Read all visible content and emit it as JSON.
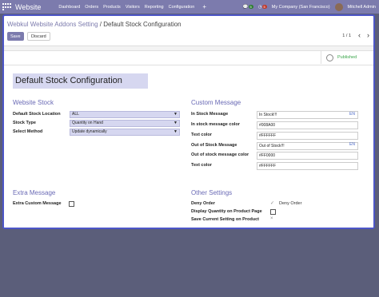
{
  "topbar": {
    "app_name": "Website",
    "menu": [
      "Dashboard",
      "Orders",
      "Products",
      "Visitors",
      "Reporting",
      "Configuration"
    ],
    "plus": "+",
    "chat_count": "5",
    "activity_count": "5",
    "company": "My Company (San Francisco)",
    "user": "Mitchell Admin"
  },
  "breadcrumb": {
    "parent": "Webkul Website Addons Setting",
    "separator": " / ",
    "current": "Default Stock Configuration"
  },
  "buttons": {
    "save": "Save",
    "discard": "Discard"
  },
  "pager": {
    "text": "1 / 1",
    "prev": "‹",
    "next": "›"
  },
  "status": {
    "published": "Published"
  },
  "record_name": "Default Stock Configuration",
  "website_stock": {
    "title": "Website Stock",
    "location_label": "Default Stock Location",
    "location_value": "ALL",
    "type_label": "Stock Type",
    "type_value": "Quantity on Hand",
    "method_label": "Select Method",
    "method_value": "Update dynamically"
  },
  "custom_message": {
    "title": "Custom Message",
    "in_stock_label": "In Stock Message",
    "in_stock_value": "In Stock!!!",
    "in_color_label": "In stock message color",
    "in_color_value": "#008A00",
    "text_color_label": "Text color",
    "text_color_value": "#FFFFFF",
    "out_label": "Out of Stock Message",
    "out_value": "Out of Stock!!!",
    "out_color_label": "Out of stock message color",
    "out_color_value": "#FF0000",
    "text_color2_label": "Text color",
    "text_color2_value": "#FFFFFF",
    "lang": "EN"
  },
  "extra_message": {
    "title": "Extra Message",
    "custom_label": "Extra Custom Message"
  },
  "other_settings": {
    "title": "Other Settings",
    "deny_label": "Deny Order",
    "deny_value": "Deny Order",
    "display_qty_label": "Display Quantity on Product Page",
    "save_current_label": "Save Current Setting on Product"
  },
  "colors": {
    "accent": "#7c7bad",
    "highlight": "#d6d7f0",
    "published": "#3aa54a",
    "modal_border": "#4d56c8"
  }
}
